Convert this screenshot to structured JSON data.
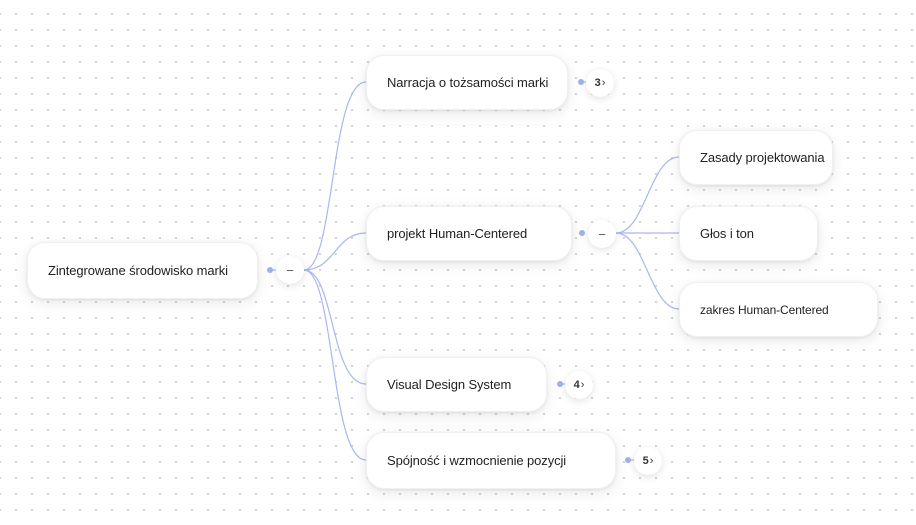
{
  "colors": {
    "edge": "#a9b7f0",
    "dot": "#9fb0ee"
  },
  "root": {
    "label": "Zintegrowane środowisko marki",
    "toggle": "−"
  },
  "branches": [
    {
      "label": "Narracja o tożsamości marki",
      "badge_count": "3",
      "chevron": "›"
    },
    {
      "label": "projekt Human-Centered",
      "toggle": "−",
      "children": [
        {
          "label": "Zasady projektowania"
        },
        {
          "label": "Głos i ton"
        },
        {
          "label": "zakres Human-Centered"
        }
      ]
    },
    {
      "label": "Visual Design System",
      "badge_count": "4",
      "chevron": "›"
    },
    {
      "label": "Spójność i wzmocnienie pozycji",
      "badge_count": "5",
      "chevron": "›"
    }
  ]
}
